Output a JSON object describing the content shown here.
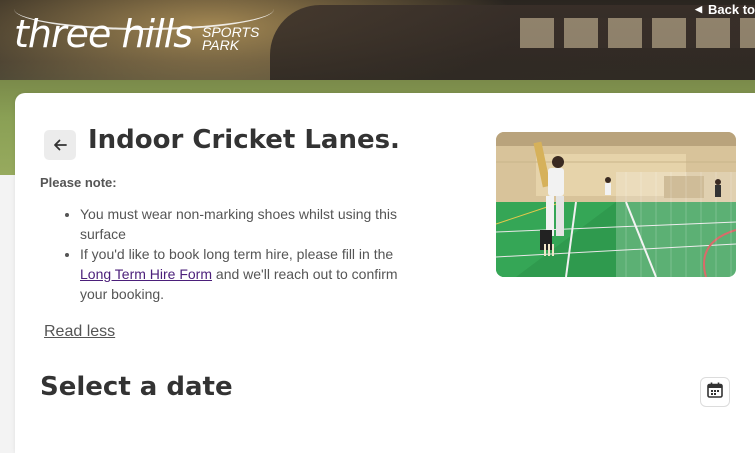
{
  "header": {
    "logo_main": "three hills",
    "logo_sub_line1": "SPORTS",
    "logo_sub_line2": "PARK",
    "back_link": "Back to"
  },
  "facility": {
    "title": "Indoor Cricket Lanes.",
    "note_heading": "Please note:",
    "notes": {
      "item1": "You must wear non-marking shoes whilst using this surface",
      "item2_before": "If you'd like to book long term hire, please fill in the ",
      "item2_link": "Long Term Hire Form",
      "item2_after": " and we'll reach out to confirm your booking."
    },
    "read_less": "Read less"
  },
  "date_section": {
    "title": "Select a date"
  },
  "icons": {
    "back": "arrow-left-icon",
    "calendar": "calendar-icon",
    "back_link": "caret-left-icon"
  },
  "colors": {
    "title_text": "#333333",
    "body_text": "#555555",
    "link": "#4b1f7a",
    "court_green": "#2f9a4e"
  }
}
